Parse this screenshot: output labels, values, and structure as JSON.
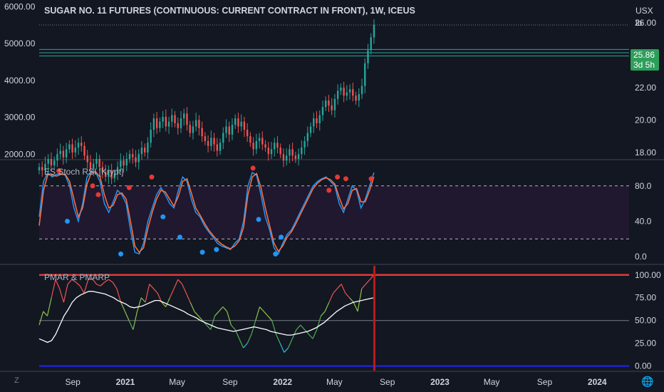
{
  "header": {
    "title": "SUGAR NO. 11 FUTURES (CONTINUOUS: CURRENT CONTRACT IN FRONT), 1W, ICEUS",
    "currency": "USX",
    "unit": "lb"
  },
  "price_badge": {
    "value": "25.86",
    "countdown": "3d 5h",
    "color": "#2e9e5b"
  },
  "pane_titles": {
    "stoch": "ES Stoch RSI [Krypt]",
    "pmar": "PMAR & PMARP"
  },
  "footer": {
    "z_label": "Z",
    "globe_icon": "globe-icon"
  },
  "colors": {
    "up": "#26a69a",
    "down": "#ef5350",
    "bg": "#131722",
    "grid": "#2a2e39"
  },
  "chart_data": [
    {
      "type": "candlestick",
      "title": "SUGAR NO. 11 FUTURES (CONTINUOUS: CURRENT CONTRACT IN FRONT), 1W, ICEUS",
      "right_axis_ticks": [
        "26.00",
        "24.00",
        "22.00",
        "20.00",
        "18.00"
      ],
      "left_axis_ticks": [
        "6000.00",
        "5000.00",
        "4000.00",
        "3000.00",
        "2000.00"
      ],
      "ylim": [
        17.6,
        27.4
      ],
      "left_ylim": [
        1870,
        6180
      ],
      "last_price": 25.86,
      "horizontal_lines": [
        24.35,
        24.15,
        23.95
      ],
      "x_start": "2020-06-15",
      "weekly_close": [
        17.1,
        16.9,
        17.3,
        17.6,
        17.2,
        17.5,
        17.9,
        18.1,
        17.7,
        18.2,
        18.5,
        18.0,
        18.3,
        18.6,
        18.4,
        17.8,
        17.4,
        17.0,
        17.3,
        17.6,
        17.1,
        16.8,
        16.5,
        16.9,
        16.4,
        16.7,
        17.1,
        17.5,
        17.2,
        17.6,
        17.9,
        17.7,
        17.4,
        17.9,
        18.3,
        18.0,
        18.6,
        19.4,
        20.1,
        19.5,
        19.9,
        20.2,
        19.6,
        19.9,
        20.3,
        19.8,
        19.5,
        20.1,
        20.4,
        19.7,
        19.2,
        19.6,
        20.0,
        19.5,
        19.0,
        18.7,
        18.4,
        18.9,
        18.5,
        18.1,
        18.6,
        19.2,
        19.6,
        19.1,
        19.7,
        20.1,
        19.6,
        19.9,
        19.4,
        19.0,
        18.6,
        18.2,
        18.7,
        18.9,
        18.5,
        18.3,
        17.9,
        18.2,
        18.6,
        18.3,
        17.9,
        17.5,
        17.8,
        18.2,
        17.8,
        17.6,
        17.9,
        18.3,
        18.7,
        19.2,
        19.6,
        20.1,
        19.8,
        20.3,
        20.8,
        21.2,
        20.9,
        20.6,
        21.3,
        21.8,
        22.0,
        21.5,
        21.7,
        21.9,
        21.5,
        21.2,
        21.6,
        22.1,
        23.5,
        24.3,
        25.1,
        25.86
      ],
      "x_ticks": [
        "Sep",
        "2021",
        "May",
        "Sep",
        "2022",
        "May",
        "Sep",
        "2023",
        "May",
        "Sep",
        "2024"
      ],
      "x_tick_dates": [
        "2020-09-01",
        "2021-01-01",
        "2021-05-01",
        "2021-09-01",
        "2022-01-01",
        "2022-05-01",
        "2022-09-01",
        "2023-01-01",
        "2023-05-01",
        "2023-09-01",
        "2024-01-01"
      ]
    },
    {
      "type": "line",
      "title": "ES Stoch RSI [Krypt]",
      "ylim": [
        -8,
        108
      ],
      "y_ticks": [
        "80.0",
        "40.0",
        "0.0"
      ],
      "y_tick_values": [
        80,
        40,
        0
      ],
      "bands": [
        80,
        20
      ],
      "series": [
        {
          "values": [
            45,
            85,
            95,
            90,
            93,
            94,
            92,
            80,
            55,
            40,
            60,
            90,
            97,
            95,
            85,
            60,
            50,
            62,
            75,
            70,
            60,
            30,
            5,
            3,
            15,
            40,
            55,
            70,
            78,
            70,
            60,
            55,
            75,
            90,
            85,
            65,
            50,
            45,
            35,
            28,
            22,
            15,
            12,
            10,
            8,
            15,
            20,
            40,
            80,
            95,
            92,
            70,
            45,
            30,
            10,
            3,
            15,
            25,
            30,
            40,
            50,
            60,
            70,
            80,
            85,
            88,
            90,
            85,
            80,
            60,
            50,
            65,
            80,
            75,
            55,
            65,
            80,
            95
          ],
          "color": "#2196f3"
        },
        {
          "values": [
            35,
            75,
            93,
            92,
            91,
            93,
            93,
            85,
            65,
            45,
            55,
            82,
            95,
            96,
            90,
            70,
            55,
            58,
            70,
            72,
            65,
            40,
            12,
            5,
            10,
            32,
            50,
            65,
            75,
            73,
            65,
            57,
            68,
            85,
            88,
            72,
            55,
            47,
            38,
            30,
            24,
            18,
            14,
            11,
            9,
            12,
            18,
            33,
            70,
            90,
            94,
            78,
            55,
            35,
            15,
            6,
            12,
            22,
            28,
            37,
            47,
            57,
            67,
            77,
            83,
            87,
            89,
            87,
            82,
            67,
            54,
            60,
            75,
            77,
            62,
            62,
            75,
            90
          ],
          "color": "#ff7043"
        }
      ],
      "signals_top": [
        [
          7,
          97
        ],
        [
          19,
          80
        ],
        [
          21,
          70
        ],
        [
          32,
          78
        ],
        [
          40,
          90
        ],
        [
          76,
          100
        ],
        [
          103,
          75
        ],
        [
          106,
          90
        ],
        [
          109,
          88
        ],
        [
          118,
          88
        ]
      ],
      "signals_bottom": [
        [
          10,
          40
        ],
        [
          29,
          3
        ],
        [
          44,
          45
        ],
        [
          50,
          22
        ],
        [
          58,
          5
        ],
        [
          63,
          8
        ],
        [
          78,
          42
        ],
        [
          84,
          3
        ],
        [
          86,
          22
        ]
      ]
    },
    {
      "type": "line",
      "title": "PMAR & PMARP",
      "ylim": [
        -5,
        110
      ],
      "y_ticks": [
        "100.00",
        "75.00",
        "50.00",
        "25.00",
        "0.00"
      ],
      "y_tick_values": [
        100,
        75,
        50,
        25,
        0
      ],
      "hlines": [
        {
          "y": 100,
          "color": "#e53935"
        },
        {
          "y": 0,
          "color": "#1e22c9"
        },
        {
          "y": 50,
          "color": "#787b86"
        }
      ],
      "series": [
        {
          "values": [
            45,
            60,
            55,
            75,
            95,
            85,
            70,
            90,
            95,
            92,
            88,
            80,
            95,
            96,
            90,
            88,
            92,
            95,
            92,
            85,
            70,
            60,
            50,
            40,
            60,
            75,
            70,
            90,
            85,
            80,
            70,
            65,
            75,
            85,
            95,
            90,
            80,
            70,
            60,
            55,
            50,
            45,
            40,
            55,
            60,
            65,
            60,
            45,
            40,
            30,
            20,
            25,
            35,
            50,
            65,
            60,
            55,
            50,
            35,
            25,
            15,
            20,
            30,
            40,
            45,
            40,
            35,
            30,
            40,
            55,
            60,
            70,
            80,
            85,
            90,
            80,
            75,
            70,
            60,
            85,
            90,
            95,
            100
          ],
          "color": "gradient"
        },
        {
          "values": [
            30,
            28,
            26,
            28,
            35,
            45,
            55,
            62,
            70,
            75,
            78,
            80,
            82,
            82,
            81,
            80,
            79,
            77,
            75,
            72,
            70,
            68,
            65,
            64,
            65,
            66,
            68,
            70,
            72,
            72,
            70,
            68,
            66,
            64,
            62,
            60,
            57,
            55,
            53,
            50,
            48,
            46,
            44,
            42,
            41,
            40,
            39,
            38,
            39,
            40,
            41,
            42,
            43,
            42,
            41,
            40,
            38,
            37,
            36,
            35,
            34,
            34,
            35,
            36,
            37,
            38,
            40,
            42,
            45,
            48,
            52,
            56,
            60,
            63,
            66,
            68,
            70,
            71,
            72,
            73,
            74,
            75
          ],
          "color": "#ffffff"
        }
      ]
    }
  ]
}
